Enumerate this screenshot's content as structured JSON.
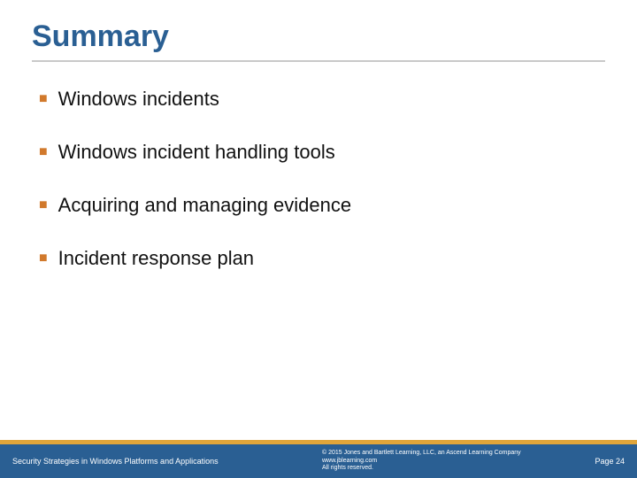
{
  "title": "Summary",
  "bullets": [
    "Windows incidents",
    "Windows incident handling tools",
    "Acquiring and managing evidence",
    "Incident response plan"
  ],
  "footer": {
    "left": "Security Strategies in Windows Platforms and Applications",
    "copyright_line1": "© 2015 Jones and Bartlett Learning, LLC, an Ascend Learning Company",
    "copyright_line2": "www.jblearning.com",
    "copyright_line3": "All rights reserved.",
    "page_label": "Page 24"
  }
}
